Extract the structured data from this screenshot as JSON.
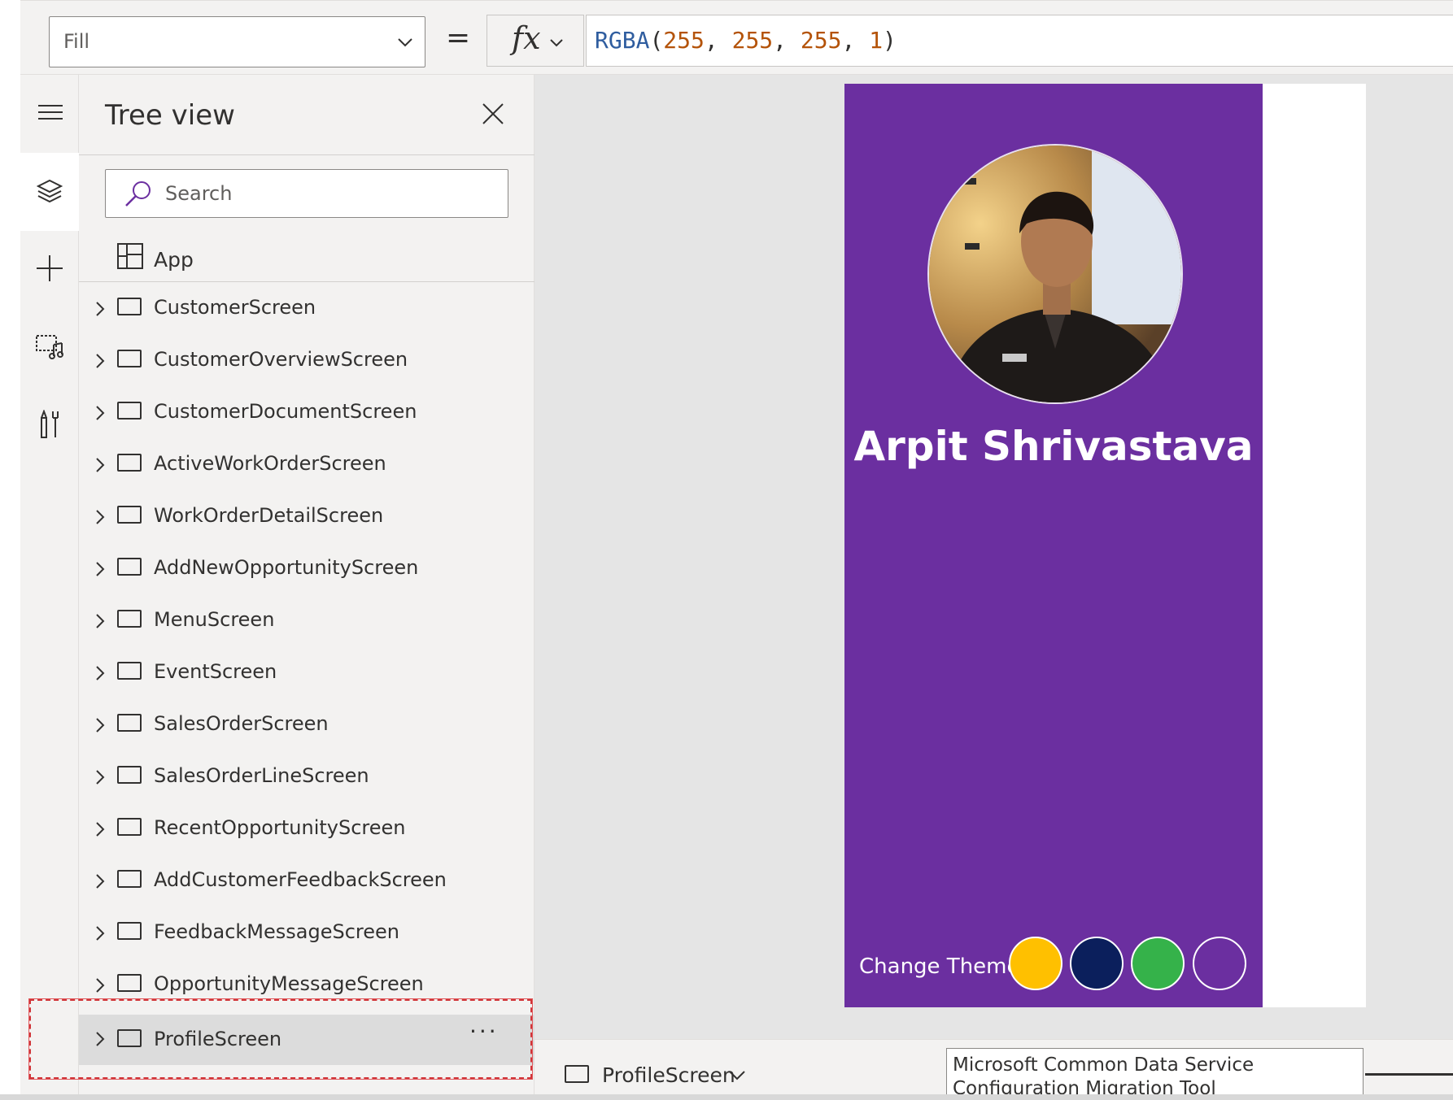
{
  "formula_bar": {
    "property": "Fill",
    "equals": "=",
    "fx": "fx",
    "formula_fn": "RGBA",
    "formula_open": "(",
    "formula_args": [
      "255",
      "255",
      "255",
      "1"
    ],
    "formula_sep": ", ",
    "formula_close": ")"
  },
  "left_rail": {
    "items": [
      "menu-icon",
      "layers-icon",
      "plus-icon",
      "media-icon",
      "tools-icon"
    ]
  },
  "tree_view": {
    "title": "Tree view",
    "search_placeholder": "Search",
    "app_label": "App",
    "screens": [
      "CustomerScreen",
      "CustomerOverviewScreen",
      "CustomerDocumentScreen",
      "ActiveWorkOrderScreen",
      "WorkOrderDetailScreen",
      "AddNewOpportunityScreen",
      "MenuScreen",
      "EventScreen",
      "SalesOrderScreen",
      "SalesOrderLineScreen",
      "RecentOpportunityScreen",
      "AddCustomerFeedbackScreen",
      "FeedbackMessageScreen",
      "OpportunityMessageScreen",
      "ProfileScreen"
    ],
    "selected_screen": "ProfileScreen",
    "more_label": "···"
  },
  "canvas": {
    "profile_name": "Arpit Shrivastava",
    "change_theme_label": "Change Theme",
    "theme_colors": [
      "#ffc000",
      "#0b1f5c",
      "#35b24a",
      "#6b2fa0"
    ],
    "card_color": "#6b2fa0"
  },
  "bottom_bar": {
    "current_screen": "ProfileScreen",
    "tooltip": "Microsoft Common Data Service Configuration Migration Tool"
  }
}
